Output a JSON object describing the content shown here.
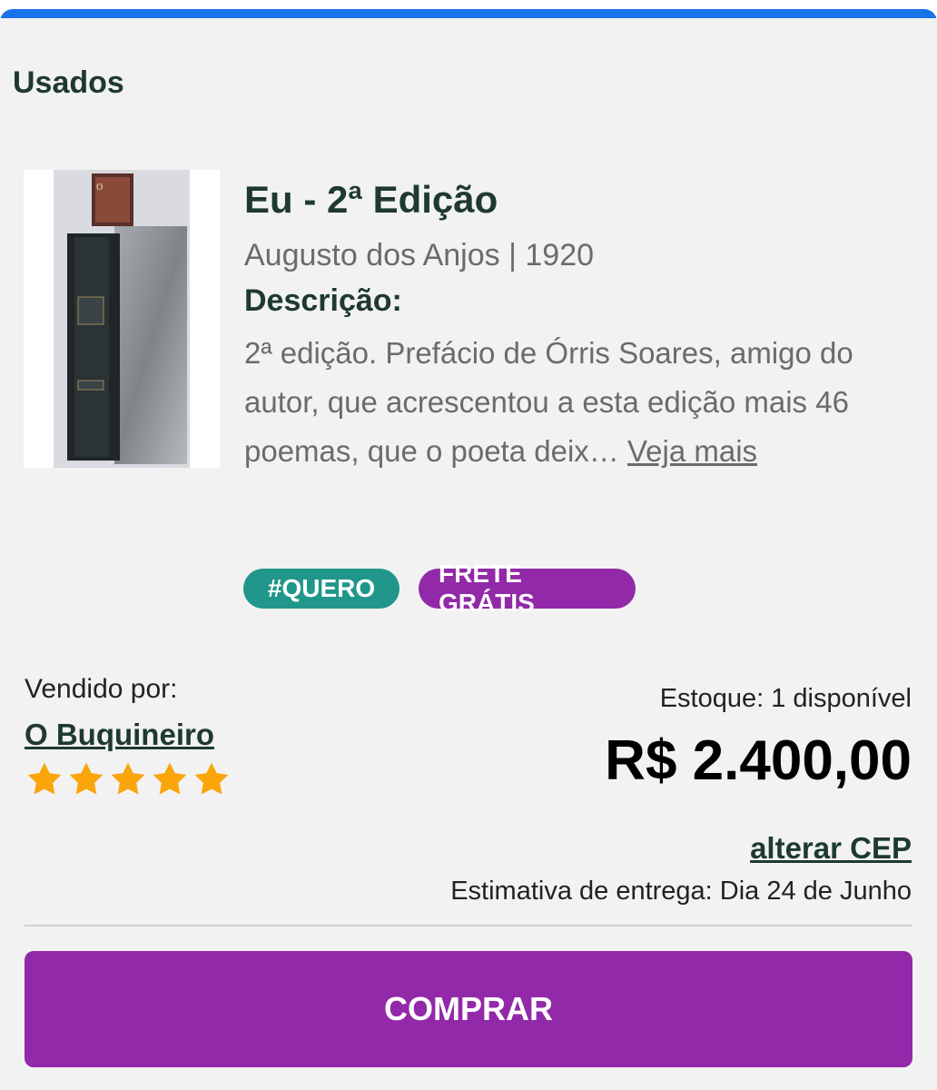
{
  "section": {
    "title": "Usados"
  },
  "product": {
    "title": "Eu - 2ª Edição",
    "author_year": "Augusto dos Anjos | 1920",
    "description_label": "Descrição:",
    "description_text": "2ª edição. Prefácio de Órris Soares, amigo do autor, que acrescentou a esta edição mais 46 poemas, que o poeta deix…",
    "see_more_label": "Veja mais",
    "tags": [
      "#QUERO",
      "FRETE GRÁTIS"
    ]
  },
  "seller": {
    "sold_by_label": "Vendido por:",
    "name": "O Buquineiro",
    "rating": 5,
    "rating_max": 5
  },
  "purchase": {
    "stock_label": "Estoque: 1 disponível",
    "price": "R$ 2.400,00",
    "change_cep_label": "alterar CEP",
    "delivery_estimate": "Estimativa de entrega: Dia 24 de Junho",
    "buy_label": "COMPRAR"
  },
  "colors": {
    "accent_blue": "#1a73e8",
    "tag_quero": "#21968a",
    "tag_frete": "#9229a8",
    "buy_button": "#9229a8",
    "star": "#f9a50b",
    "heading": "#1e3932"
  }
}
